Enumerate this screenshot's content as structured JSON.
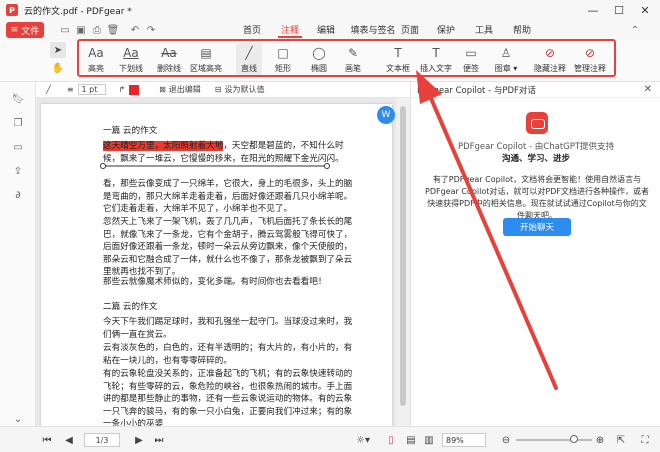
{
  "window": {
    "title": "云的作文.pdf - PDFgear *",
    "app_icon_glyph": "P"
  },
  "file_button": "文件",
  "menu": [
    "首页",
    "注释",
    "编辑",
    "填表与签名",
    "页面",
    "保护",
    "工具",
    "帮助"
  ],
  "active_menu": "注释",
  "ribbon_tools": [
    {
      "label": "高亮",
      "icon": "highlight-icon",
      "glyph": "Aa"
    },
    {
      "label": "下划线",
      "icon": "underline-icon",
      "glyph": "Aa"
    },
    {
      "label": "删除线",
      "icon": "strikethrough-icon",
      "glyph": "Aa"
    },
    {
      "label": "区域高亮",
      "icon": "area-highlight-icon",
      "glyph": "▤"
    },
    {
      "label": "直线",
      "icon": "line-icon",
      "glyph": "╱"
    },
    {
      "label": "矩形",
      "icon": "rectangle-icon",
      "glyph": "□"
    },
    {
      "label": "椭圆",
      "icon": "ellipse-icon",
      "glyph": "◯"
    },
    {
      "label": "画笔",
      "icon": "pen-icon",
      "glyph": "✎"
    },
    {
      "label": "文本框",
      "icon": "textbox-icon",
      "glyph": "T"
    },
    {
      "label": "插入文字",
      "icon": "insert-text-icon",
      "glyph": "T"
    },
    {
      "label": "便签",
      "icon": "note-icon",
      "glyph": "▭"
    },
    {
      "label": "图章",
      "icon": "stamp-icon",
      "glyph": "♙"
    },
    {
      "label": "隐藏注释",
      "icon": "hide-annotations-icon",
      "glyph": "⊘"
    },
    {
      "label": "管理注释",
      "icon": "manage-annotations-icon",
      "glyph": "⊘"
    }
  ],
  "propbar": {
    "line_width": "1 pt",
    "exit_edit": "退出编辑",
    "set_default": "设为默认值",
    "color": "#e8262a"
  },
  "document": {
    "heading1": "一篇 云的作文",
    "para1_highlight": "这天晴空万里，太阳照射着大地",
    "para1_rest": "，天空都是碧蓝的，不知什么时候，飘来了一堆云，它慢慢的移来，在阳光的照耀下金光闪闪。",
    "para2": "看，那些云像变成了一只绵羊，它很大，身上的毛很多，头上的脑是弯曲的，那只大绵羊走着走着，后面好像还跟着几只小绵羊呢。它们走着走着，大绵羊不见了，小绵羊也不见了。",
    "para3": "忽然天上飞来了一架飞机，轰了几几声，飞机后面托了条长长的尾巴，就像飞来了一条龙，它有个金胡子，腾云驾雾般飞得可快了，后面好像还跟着一条龙，顿时一朵云从旁边飘来，像个天使般的，那朵云和它融合成了一体，就什么也不像了，那条龙被飘到了朵云里就再也找不到了。",
    "para4": "那些云就像魔术师似的，变化多端。有时间你也去看看吧！",
    "heading2": "二篇 云的作文",
    "para5": "今天下午我们踢足球时，我和孔强坐一起守门。当球没过来时，我们俩一直在赏云。",
    "para6": "云有淡灰色的，白色的，还有半透明的；有大片的，有小片的，有粘在一块儿的，也有零零碎碎的。",
    "para7": "有的云象轮盘没关系的，正准备起飞的飞机；有的云象快速转动的飞轮；有些零碎的云，象危险的峡谷，也很象热闹的城市。手上面讲的都是那些静止的事物，还有一些云象说运动的物体。有的云象一只飞奔的骏马，有的象一只小白兔，正要向我们冲过来；有的象一条小小的巫婆"
  },
  "copilot": {
    "title": "PDFgear Copilot - 与PDF对话",
    "line1": "PDFgear Copilot - 由ChatGPT提供支持",
    "line2": "沟通、学习、进步",
    "desc": "有了PDFgear Copilot，文档将会更智能！使用自然语言与PDFgear Copilot对话，就可以对PDF文档进行各种操作，或者快速获得PDF中的相关信息。现在就试试通过Copilot与你的文件聊天吧。",
    "button": "开始聊天"
  },
  "status": {
    "page_input": "1/3",
    "zoom": "89%"
  },
  "colors": {
    "accent": "#e8403a",
    "blue": "#2d8cf0",
    "highlight": "#e83a2e"
  }
}
